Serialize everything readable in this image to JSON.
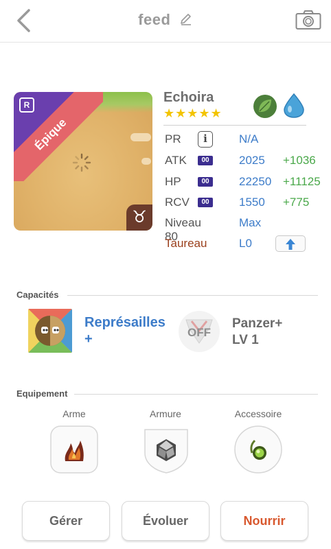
{
  "header": {
    "title": "feed",
    "icons": {
      "back": "chevron-left-icon",
      "edit": "pencil-icon",
      "camera": "camera-icon"
    }
  },
  "monster": {
    "rarity": "Épique",
    "rarity_badge": "R",
    "zodiac_symbol": "♉",
    "name": "Echoira",
    "stars": "★★★★★",
    "star_count": 5,
    "elements": [
      "leaf-icon",
      "water-drop-icon"
    ],
    "stats": {
      "pr": {
        "label": "PR",
        "value": "N/A",
        "info": "i"
      },
      "atk": {
        "label": "ATK",
        "badge": "00",
        "value": "2025",
        "bonus": "+1036"
      },
      "hp": {
        "label": "HP",
        "badge": "00",
        "value": "22250",
        "bonus": "+11125"
      },
      "rcv": {
        "label": "RCV",
        "badge": "00",
        "value": "1550",
        "bonus": "+775"
      },
      "level": {
        "label": "Niveau 80",
        "value": "Max"
      },
      "zodiac": {
        "label": "Taureau",
        "value": "L0"
      }
    }
  },
  "abilities": {
    "title": "Capacités",
    "skill": {
      "name": "Représailles",
      "suffix": "+"
    },
    "awakening": {
      "status": "OFF",
      "name": "Panzer+",
      "level": "LV 1"
    }
  },
  "equipment": {
    "title": "Equipement",
    "slots": [
      {
        "label": "Arme"
      },
      {
        "label": "Armure"
      },
      {
        "label": "Accessoire"
      }
    ]
  },
  "actions": {
    "manage": "Gérer",
    "evolve": "Évoluer",
    "feed": "Nourrir"
  },
  "colors": {
    "accent_blue": "#3d7cc9",
    "bonus_green": "#4aa84a",
    "feed_orange": "#d8582e",
    "star": "#f3c400"
  }
}
